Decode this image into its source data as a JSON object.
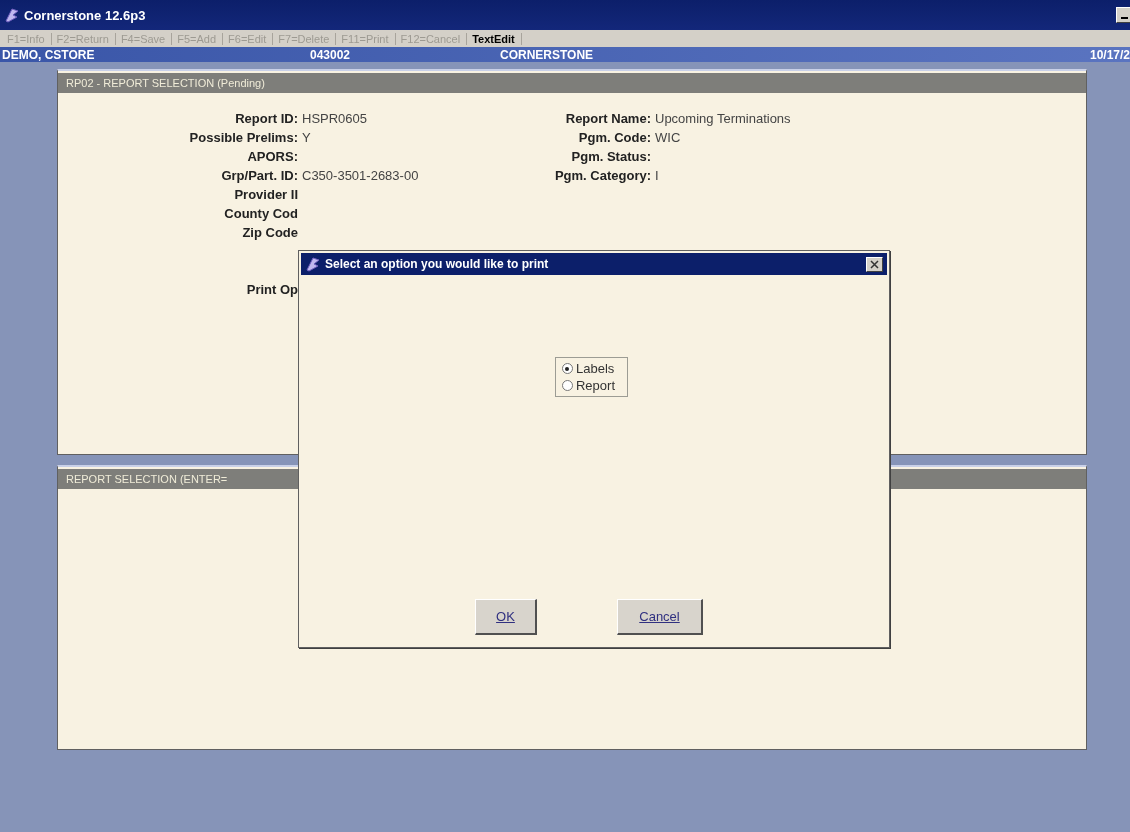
{
  "window": {
    "title": "Cornerstone 12.6p3"
  },
  "toolbar": [
    {
      "label": "F1=Info",
      "disabled": true
    },
    {
      "label": "F2=Return",
      "disabled": true
    },
    {
      "label": "F4=Save",
      "disabled": true
    },
    {
      "label": "F5=Add",
      "disabled": true
    },
    {
      "label": "F6=Edit",
      "disabled": true
    },
    {
      "label": "F7=Delete",
      "disabled": true
    },
    {
      "label": "F11=Print",
      "disabled": true
    },
    {
      "label": "F12=Cancel",
      "disabled": true
    },
    {
      "label": "TextEdit",
      "disabled": false
    }
  ],
  "header": {
    "user": "DEMO, CSTORE",
    "code": "043002",
    "system": "CORNERSTONE",
    "date": "10/17/2"
  },
  "report_panel": {
    "title": "RP02 - REPORT SELECTION (Pending)",
    "left_fields": [
      {
        "label": "Report ID:",
        "value": "HSPR0605"
      },
      {
        "label": "Possible Prelims:",
        "value": "Y"
      },
      {
        "label": "APORS:"
      },
      {
        "label": "Grp/Part. ID:",
        "value": "C350-3501-2683-00"
      },
      {
        "label": "Provider II"
      },
      {
        "label": "County Cod"
      },
      {
        "label": "Zip Code"
      }
    ],
    "right_fields": [
      {
        "label": "Report Name:",
        "value": "Upcoming Terminations"
      },
      {
        "label": "Pgm. Code:",
        "value": "WIC"
      },
      {
        "label": "Pgm. Status:"
      },
      {
        "label": "Pgm. Category:",
        "value": "I"
      }
    ],
    "print_option_label": "Print Op"
  },
  "selection_panel": {
    "title": "REPORT SELECTION (ENTER="
  },
  "dialog": {
    "title": "Select an option you would like to print",
    "options": [
      {
        "label": "Labels",
        "selected": true
      },
      {
        "label": "Report",
        "selected": false
      }
    ],
    "buttons": [
      "OK",
      "Cancel"
    ]
  }
}
